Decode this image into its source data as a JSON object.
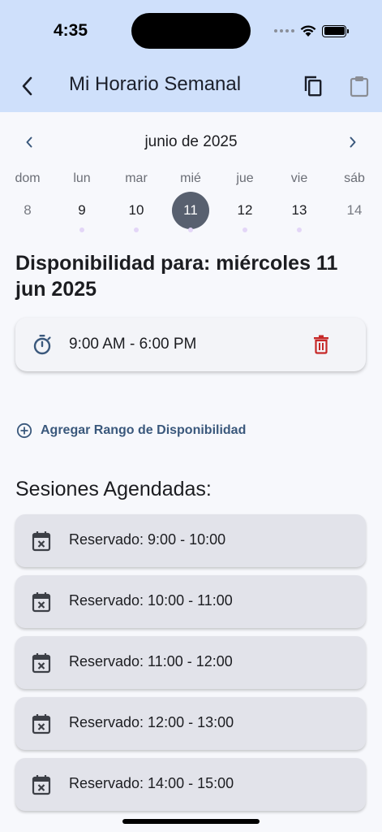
{
  "status_bar": {
    "time": "4:35"
  },
  "app_bar": {
    "title": "Mi Horario Semanal",
    "icons": {
      "back": "back-arrow-icon",
      "copy": "copy-icon",
      "paste": "clipboard-icon"
    }
  },
  "calendar": {
    "month_label": "junio de 2025",
    "days": [
      {
        "name": "dom",
        "number": "8",
        "selected": false,
        "has_dot": false,
        "muted": true
      },
      {
        "name": "lun",
        "number": "9",
        "selected": false,
        "has_dot": true,
        "muted": false
      },
      {
        "name": "mar",
        "number": "10",
        "selected": false,
        "has_dot": true,
        "muted": false
      },
      {
        "name": "mié",
        "number": "11",
        "selected": true,
        "has_dot": true,
        "muted": false
      },
      {
        "name": "jue",
        "number": "12",
        "selected": false,
        "has_dot": true,
        "muted": false
      },
      {
        "name": "vie",
        "number": "13",
        "selected": false,
        "has_dot": true,
        "muted": false
      },
      {
        "name": "sáb",
        "number": "14",
        "selected": false,
        "has_dot": false,
        "muted": true
      }
    ]
  },
  "availability": {
    "heading": "Disponibilidad para: miércoles 11 jun 2025",
    "ranges": [
      {
        "label": "9:00 AM - 6:00 PM"
      }
    ],
    "add_label": "Agregar Rango de Disponibilidad"
  },
  "sessions": {
    "heading": "Sesiones Agendadas:",
    "items": [
      {
        "label": "Reservado: 9:00 - 10:00"
      },
      {
        "label": "Reservado: 10:00 - 11:00"
      },
      {
        "label": "Reservado: 11:00 - 12:00"
      },
      {
        "label": "Reservado: 12:00 - 13:00"
      },
      {
        "label": "Reservado: 14:00 - 15:00"
      }
    ]
  },
  "colors": {
    "app_bar": "#cfe0fb",
    "accent": "#3a587c",
    "selected_day": "#58606f",
    "delete": "#c62828",
    "session_card": "#e2e3ea"
  }
}
